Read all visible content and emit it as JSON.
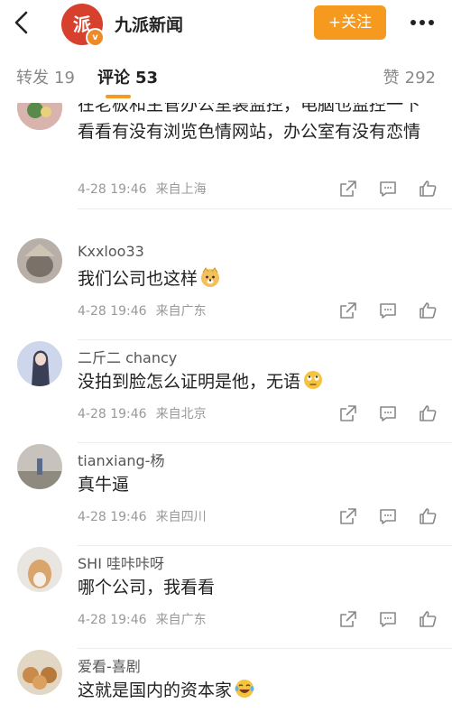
{
  "header": {
    "account_name": "九派新闻",
    "logo_text": "派",
    "verified_badge": "v",
    "follow_label": "+关注"
  },
  "tabs": {
    "repost_label": "转发",
    "repost_count": "19",
    "comment_label": "评论",
    "comment_count": "53",
    "like_label": "赞",
    "like_count": "292"
  },
  "comments": [
    {
      "username": "",
      "text": "在老板和主管办公室装监控，电脑也监控一下 看看有没有浏览色情网站，办公室有没有恋情",
      "time": "4-28 19:46",
      "location": "来自上海"
    },
    {
      "username": "Kxxloo33",
      "text": "我们公司也这样",
      "emoji": "doge-emoji",
      "time": "4-28 19:46",
      "location": "来自广东"
    },
    {
      "username": "二斤二 chancy",
      "text": "没拍到脸怎么证明是他，无语",
      "emoji": "eye-roll-emoji",
      "time": "4-28 19:46",
      "location": "来自北京"
    },
    {
      "username": "tianxiang-杨",
      "text": "真牛逼",
      "time": "4-28 19:46",
      "location": "来自四川"
    },
    {
      "username": "SHI 哇咔咔呀",
      "text": "哪个公司，我看看",
      "time": "4-28 19:46",
      "location": "来自广东"
    },
    {
      "username": "爱看-喜剧",
      "text": "这就是国内的资本家",
      "emoji": "laugh-cry-emoji",
      "time": "",
      "location": ""
    }
  ],
  "icons": {
    "back": "chevron-left-icon",
    "more": "more-horizontal-icon",
    "share": "share-icon",
    "reply": "comment-icon",
    "like": "thumbs-up-icon"
  },
  "colors": {
    "accent": "#f59a1e",
    "logo_red": "#d8402e",
    "divider": "#ececec"
  }
}
